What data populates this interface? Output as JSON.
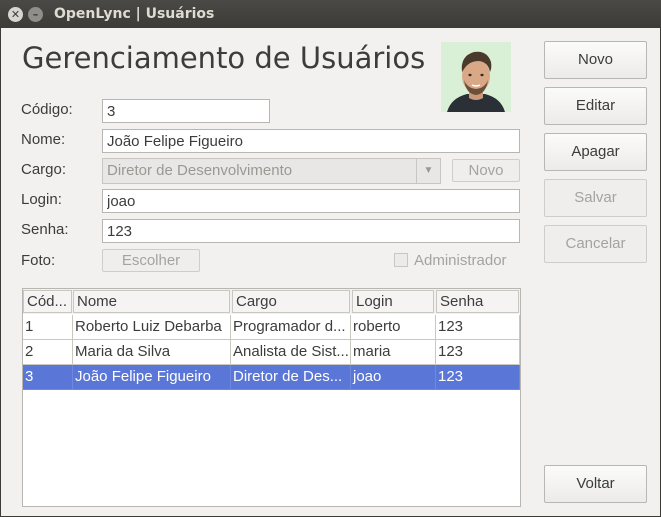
{
  "window": {
    "title": "OpenLync | Usuários"
  },
  "heading": "Gerenciamento de Usuários",
  "form": {
    "codigo": {
      "label": "Código:",
      "value": "3"
    },
    "nome": {
      "label": "Nome:",
      "value": "João Felipe Figueiro"
    },
    "cargo": {
      "label": "Cargo:",
      "value": "Diretor de Desenvolvimento",
      "new_label": "Novo"
    },
    "login": {
      "label": "Login:",
      "value": "joao"
    },
    "senha": {
      "label": "Senha:",
      "value": "123"
    },
    "foto": {
      "label": "Foto:",
      "button_label": "Escolher"
    },
    "administrador": {
      "label": "Administrador",
      "checked": false
    }
  },
  "actions": {
    "novo": "Novo",
    "editar": "Editar",
    "apagar": "Apagar",
    "salvar": "Salvar",
    "cancelar": "Cancelar",
    "voltar": "Voltar"
  },
  "table": {
    "headers": [
      "Cód...",
      "Nome",
      "Cargo",
      "Login",
      "Senha"
    ],
    "rows": [
      [
        "1",
        "Roberto Luiz Debarba",
        "Programador d...",
        "roberto",
        "123"
      ],
      [
        "2",
        "Maria da Silva",
        "Analista de Sist...",
        "maria",
        "123"
      ],
      [
        "3",
        "João Felipe Figueiro",
        "Diretor de Des...",
        "joao",
        "123"
      ]
    ],
    "selected_row": 2
  },
  "colors": {
    "selection": "#5a76d6",
    "titlebar": "#3c3b37"
  }
}
